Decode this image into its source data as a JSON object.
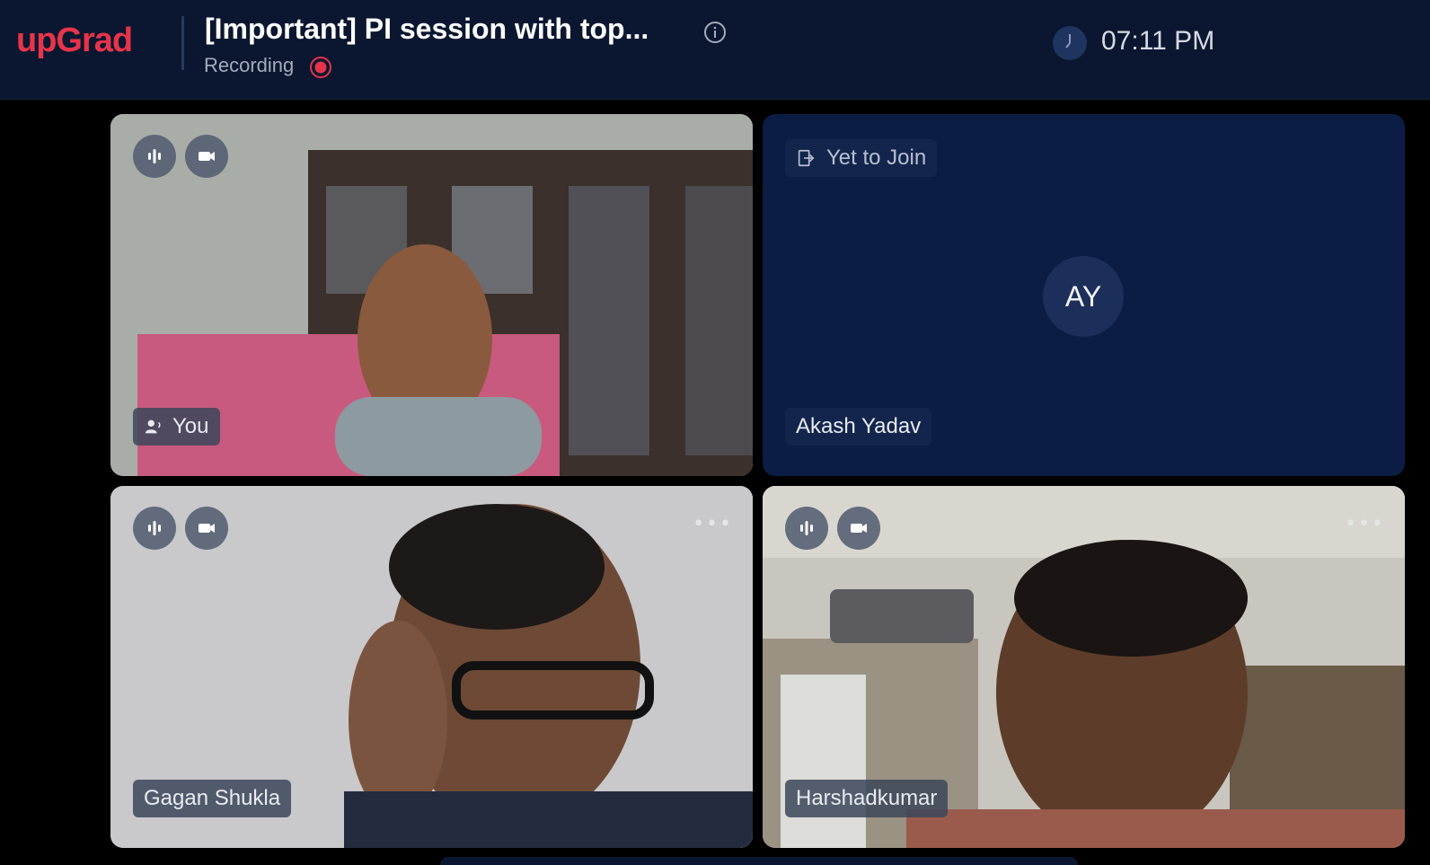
{
  "header": {
    "logo": "upGrad",
    "title": "[Important] PI session with top...",
    "recording_label": "Recording",
    "time": "07:11 PM"
  },
  "tiles": [
    {
      "name": "You",
      "status": "",
      "initials": ""
    },
    {
      "name": "Akash Yadav",
      "status": "Yet to Join",
      "initials": "AY"
    },
    {
      "name": "Gagan Shukla",
      "status": "",
      "initials": ""
    },
    {
      "name": "Harshadkumar",
      "status": "",
      "initials": ""
    }
  ],
  "colors": {
    "brand": "#e8344a",
    "header_bg": "#0b1730",
    "tile_dark": "#0b1d44",
    "recording": "#e8344a"
  },
  "icons": [
    "info-icon",
    "record-icon",
    "clock-icon",
    "mic-icon",
    "camera-icon",
    "speaker-icon",
    "more-icon",
    "exit-icon"
  ]
}
